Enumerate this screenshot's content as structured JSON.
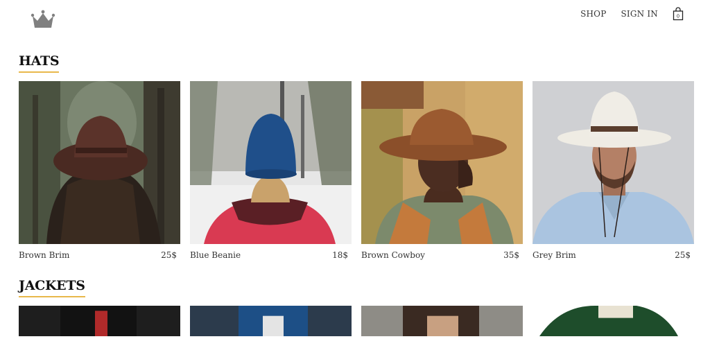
{
  "header": {
    "logo": "crown-logo",
    "nav": {
      "shop": "SHOP",
      "sign_in": "SIGN IN",
      "bag_count": "0"
    }
  },
  "sections": [
    {
      "title": "HATS",
      "items": [
        {
          "name": "Brown Brim",
          "price": "25$"
        },
        {
          "name": "Blue Beanie",
          "price": "18$"
        },
        {
          "name": "Brown Cowboy",
          "price": "35$"
        },
        {
          "name": "Grey Brim",
          "price": "25$"
        }
      ]
    },
    {
      "title": "JACKETS"
    }
  ],
  "colors": {
    "accent_underline": "#e8b84a"
  }
}
